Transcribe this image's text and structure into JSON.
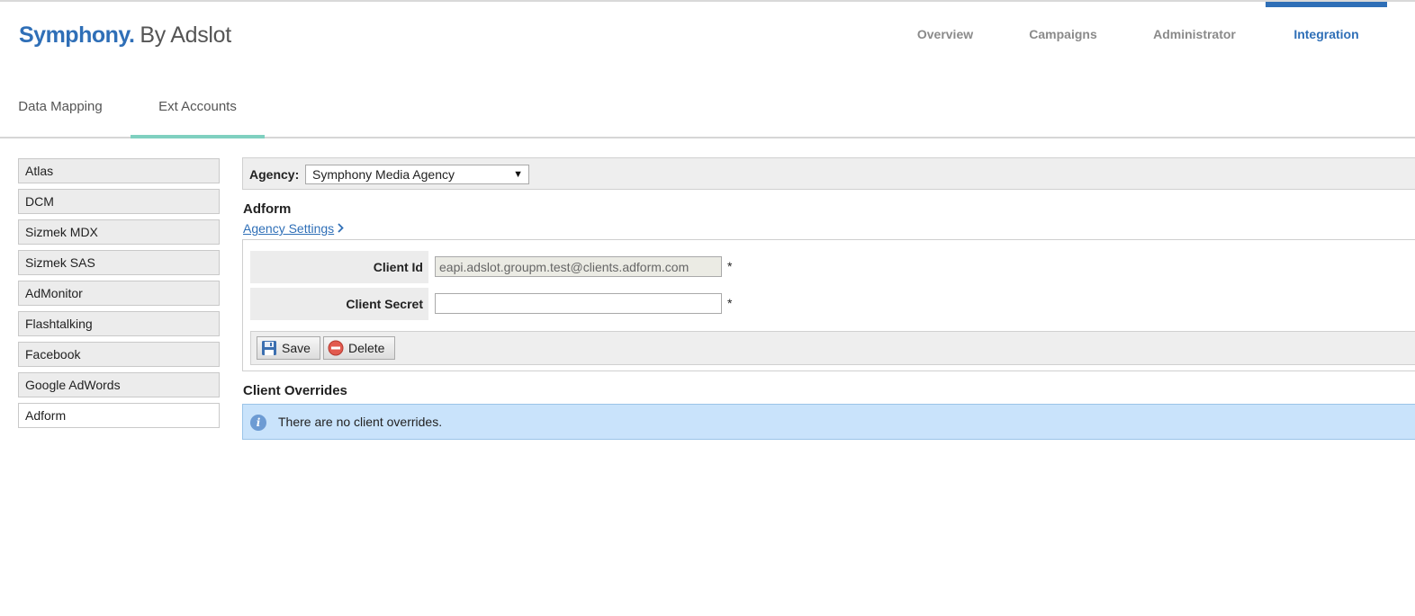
{
  "brand": {
    "name": "Symphony.",
    "by": "By Adslot"
  },
  "main_nav": {
    "overview": "Overview",
    "campaigns": "Campaigns",
    "administrator": "Administrator",
    "integration": "Integration",
    "active": "Integration"
  },
  "sub_nav": {
    "data_mapping": "Data Mapping",
    "ext_accounts": "Ext Accounts",
    "active": "Ext Accounts"
  },
  "sidebar": {
    "items": [
      {
        "label": "Atlas"
      },
      {
        "label": "DCM"
      },
      {
        "label": "Sizmek MDX"
      },
      {
        "label": "Sizmek SAS"
      },
      {
        "label": "AdMonitor"
      },
      {
        "label": "Flashtalking"
      },
      {
        "label": "Facebook"
      },
      {
        "label": "Google AdWords"
      },
      {
        "label": "Adform"
      }
    ],
    "active": "Adform"
  },
  "agency": {
    "label": "Agency:",
    "selected": "Symphony Media Agency"
  },
  "section": {
    "title": "Adform",
    "settings_link": "Agency Settings"
  },
  "form": {
    "client_id_label": "Client Id",
    "client_id_value": "eapi.adslot.groupm.test@clients.adform.com",
    "client_secret_label": "Client Secret",
    "client_secret_value": "",
    "required_mark": "*"
  },
  "buttons": {
    "save": "Save",
    "delete": "Delete"
  },
  "overrides": {
    "title": "Client Overrides",
    "message": "There are no client overrides."
  },
  "colors": {
    "brand_blue": "#2f6fb7",
    "tab_underline": "#7fd0c0",
    "info_bg": "#c9e3fb"
  }
}
